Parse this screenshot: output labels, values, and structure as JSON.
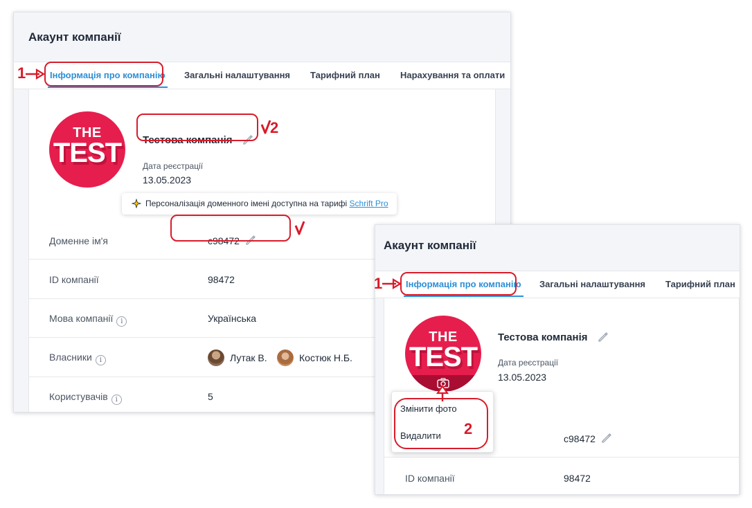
{
  "panel_a": {
    "title": "Акаунт компанії",
    "tabs": [
      {
        "label": "Інформація про компанію",
        "active": true
      },
      {
        "label": "Загальні налаштування"
      },
      {
        "label": "Тарифний план"
      },
      {
        "label": "Нарахування та оплати"
      }
    ],
    "logo": {
      "line1": "THE",
      "line2": "TEST"
    },
    "company_name": "Тестова компанія",
    "registration_label": "Дата реєстрації",
    "registration_date": "13.05.2023",
    "tooltip": {
      "text": "Персоналізація доменного імені доступна на тарифі",
      "link": "Schrift Pro"
    },
    "rows": [
      {
        "label": "Доменне ім'я",
        "value": "c98472"
      },
      {
        "label": "ID компанії",
        "value": "98472"
      },
      {
        "label": "Мова компанії",
        "value": "Українська"
      },
      {
        "label": "Власники",
        "owners": [
          "Лутак В.",
          "Костюк Н.Б."
        ]
      },
      {
        "label": "Користувачів",
        "value": "5"
      }
    ]
  },
  "panel_b": {
    "title": "Акаунт компанії",
    "tabs": [
      {
        "label": "Інформація про компанію",
        "active": true
      },
      {
        "label": "Загальні налаштування"
      },
      {
        "label": "Тарифний план"
      }
    ],
    "logo": {
      "line1": "THE",
      "line2": "TEST"
    },
    "company_name": "Тестова компанія",
    "registration_label": "Дата реєстрації",
    "registration_date": "13.05.2023",
    "photo_menu": [
      "Змінити фото",
      "Видалити"
    ],
    "domain_value": "c98472",
    "rows": [
      {
        "label": "ID компанії",
        "value": "98472"
      }
    ]
  },
  "annotations": {
    "step1": "1",
    "step2": "2"
  },
  "icons": {
    "edit": "pencil-icon",
    "info": "info-icon",
    "camera": "camera-icon",
    "tooltip": "sparkle-icon"
  },
  "colors": {
    "accent": "#2d8fd6",
    "brand": "#e61e4d",
    "annotation": "#d81b2a"
  }
}
